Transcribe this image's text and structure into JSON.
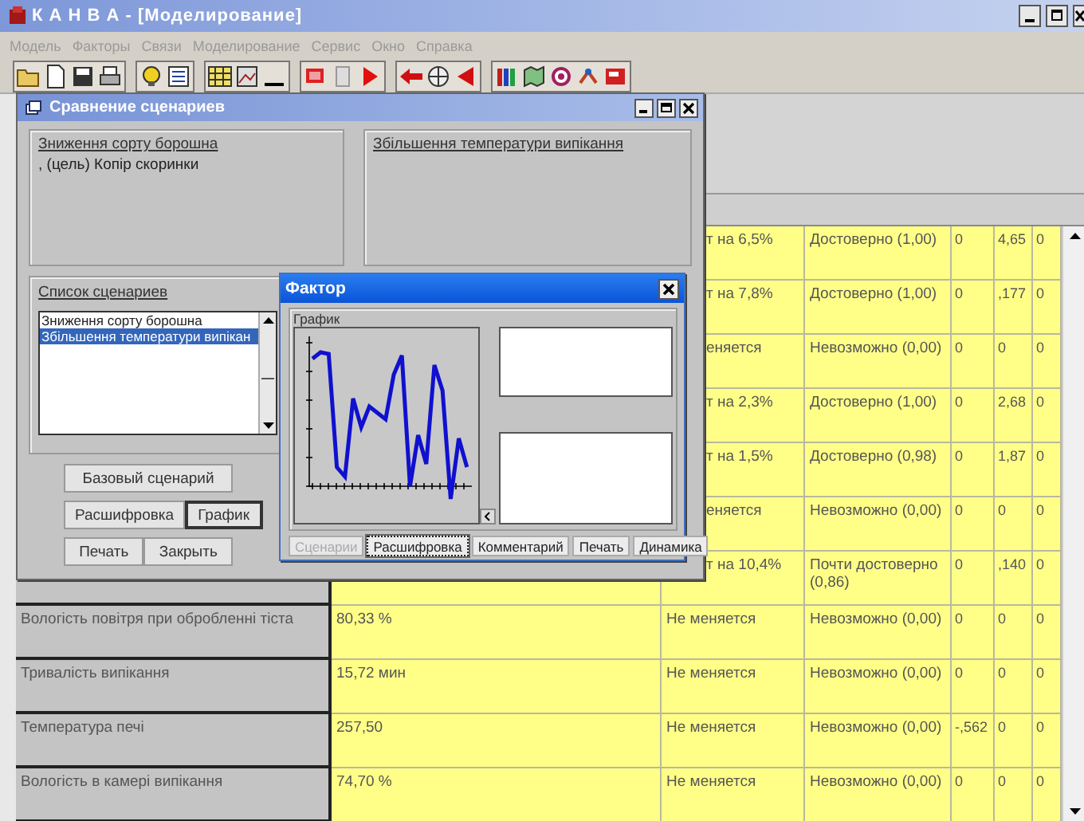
{
  "window": {
    "title": "К А Н В А - [Моделирование]"
  },
  "menu": [
    {
      "label": "Модель",
      "disabled": true
    },
    {
      "label": "Факторы",
      "disabled": true
    },
    {
      "label": "Связи",
      "disabled": true
    },
    {
      "label": "Моделирование",
      "disabled": true
    },
    {
      "label": "Сервис",
      "disabled": true
    },
    {
      "label": "Окно",
      "disabled": true
    },
    {
      "label": "Справка",
      "disabled": true
    }
  ],
  "table": {
    "rows": [
      {
        "change": "т на 6,5%",
        "probability": "Достоверно  (1,00)",
        "column_5": "0",
        "column_6": "4,65",
        "column_7": "0"
      },
      {
        "change": "т на 7,8%",
        "probability": "Достоверно  (1,00)",
        "column_5": "0",
        "column_6": ",177",
        "column_7": "0"
      },
      {
        "change": "еняется",
        "probability": "Невозможно (0,00)",
        "column_5": "0",
        "column_6": "0",
        "column_7": "0"
      },
      {
        "change": "т на 2,3%",
        "probability": "Достоверно  (1,00)",
        "column_5": "0",
        "column_6": "2,68",
        "column_7": "0"
      },
      {
        "change": "т на 1,5%",
        "probability": "Достоверно  (0,98)",
        "column_5": "0",
        "column_6": "1,87",
        "column_7": "0"
      },
      {
        "change": "еняется",
        "probability": "Невозможно (0,00)",
        "column_5": "0",
        "column_6": "0",
        "column_7": "0"
      },
      {
        "change": "т на 10,4%",
        "probability": "Почти достоверно (0,86)",
        "column_5": "0",
        "column_6": ",140",
        "column_7": "0"
      },
      {
        "name": "Вологість повітря при обробленні тіста",
        "value": "80,33 %",
        "change": "Не меняется",
        "probability": "Невозможно (0,00)",
        "column_5": "0",
        "column_6": "0",
        "column_7": "0"
      },
      {
        "name": "Тривалість випікання",
        "value": "15,72 мин",
        "change": "Не меняется",
        "probability": "Невозможно (0,00)",
        "column_5": "0",
        "column_6": "0",
        "column_7": "0"
      },
      {
        "name": "Температура печі",
        "value": "257,50",
        "change": "Не меняется",
        "probability": "Невозможно (0,00)",
        "column_5": "-,562",
        "column_6": "0",
        "column_7": "0"
      },
      {
        "name": "Вологість в камері випікання",
        "value": "74,70 %",
        "change": "Не меняется",
        "probability": "Невозможно (0,00)",
        "column_5": "0",
        "column_6": "0",
        "column_7": "0"
      }
    ]
  },
  "scenario_dialog": {
    "title": "Сравнение сценариев",
    "left_panel": {
      "title": "Зниження сорту борошна",
      "text": ", (цель) Копір скоринки"
    },
    "right_panel": {
      "title": "Збільшення температури випікання"
    },
    "list": {
      "title": "Список  сценариев",
      "items": [
        {
          "label": "Зниження сорту борошна",
          "selected": false
        },
        {
          "label": "Збільшення температури випікан",
          "selected": true
        }
      ]
    },
    "buttons": [
      {
        "label": "Базовый сценарий",
        "selected": false
      },
      {
        "label": "Расшифровка",
        "selected": false
      },
      {
        "label": "График",
        "selected": true
      },
      {
        "label": "Печать",
        "selected": false
      },
      {
        "label": "Закрыть",
        "selected": false
      }
    ]
  },
  "factor_dialog": {
    "title": "Фактор",
    "group": "График",
    "tabs": [
      {
        "label": "Сценарии",
        "disabled": true,
        "selected": false
      },
      {
        "label": "Расшифровка",
        "disabled": false,
        "selected": true
      },
      {
        "label": "Комментарий",
        "disabled": false,
        "selected": false
      },
      {
        "label": "Печать",
        "disabled": false,
        "selected": false
      },
      {
        "label": "Динамика",
        "disabled": false,
        "selected": false
      }
    ]
  }
}
